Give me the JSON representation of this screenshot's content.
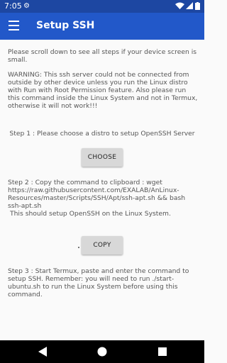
{
  "status_bar": {
    "time": "7:05",
    "settings_icon": "gear-icon",
    "wifi_icon": "wifi-icon",
    "signal_icon": "signal-icon",
    "battery_icon": "battery-icon"
  },
  "app_bar": {
    "menu_icon": "hamburger-menu-icon",
    "title": "Setup SSH",
    "color": "#2258c9"
  },
  "content": {
    "intro": "Please scroll down to see all steps if your device screen is small.",
    "warning": "WARNING: This ssh server could not be connected from outside by other device unless you run the Linux distro with Run with Root Permission feature. Also please run this command inside the Linux System and not in Termux, otherwise it will not work!!!",
    "step1": "Step 1 : Please choose a distro to setup OpenSSH Server",
    "choose_button": "CHOOSE",
    "step2": "Step 2 : Copy the command to clipboard : wget https://raw.githubusercontent.com/EXALAB/AnLinux-Resources/master/Scripts/SSH/Apt/ssh-apt.sh && bash ssh-apt.sh",
    "step2_note": "This should setup OpenSSH on the Linux System.",
    "copy_button": "COPY",
    "step3": "Step 3 : Start Termux, paste and enter the command to setup SSH. Remember: you will need to run ./start-ubuntu.sh to run the Linux System before using this command."
  },
  "nav_bar": {
    "back_icon": "back-icon",
    "home_icon": "home-icon",
    "recents_icon": "recents-icon"
  }
}
